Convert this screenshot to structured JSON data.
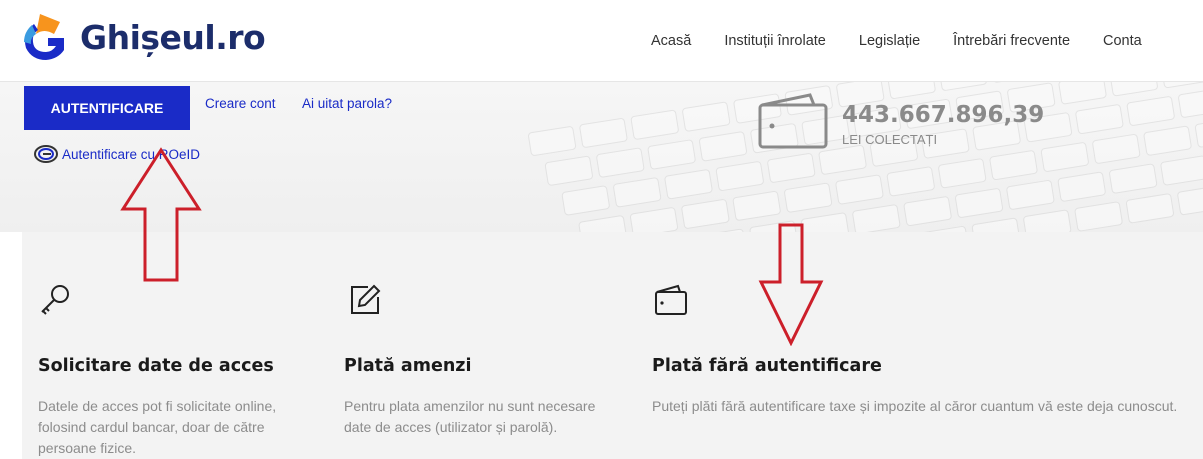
{
  "brand": {
    "name": "Ghișeul.ro",
    "logo_icon": "ghiseul-logo-icon",
    "colors": {
      "orange": "#f7941d",
      "blue": "#1a2bc7",
      "navy": "#1c2d6b"
    }
  },
  "nav": [
    {
      "label": "Acasă"
    },
    {
      "label": "Instituții înrolate"
    },
    {
      "label": "Legislație"
    },
    {
      "label": "Întrebări frecvente"
    },
    {
      "label": "Conta"
    }
  ],
  "hero": {
    "auth_button": "AUTENTIFICARE",
    "create_account": "Creare cont",
    "forgot_password": "Ai uitat parola?",
    "roeid_label": "Autentificare cu ROeID",
    "counter_value": "443.667.896,39",
    "counter_label": "LEI COLECTAȚI"
  },
  "cards": [
    {
      "icon": "key-icon",
      "title": "Solicitare date de acces",
      "text": "Datele de acces pot fi solicitate online, folosind cardul bancar, doar de către persoane fizice."
    },
    {
      "icon": "edit-icon",
      "title": "Plată amenzi",
      "text": "Pentru plata amenzilor nu sunt necesare date de acces (utilizator și parolă)."
    },
    {
      "icon": "wallet-icon",
      "title": "Plată fără autentificare",
      "text": "Puteți plăti fără autentificare taxe și impozite al căror cuantum vă este deja cunoscut."
    }
  ],
  "annotations": {
    "arrow_color": "#cc1f2a"
  }
}
